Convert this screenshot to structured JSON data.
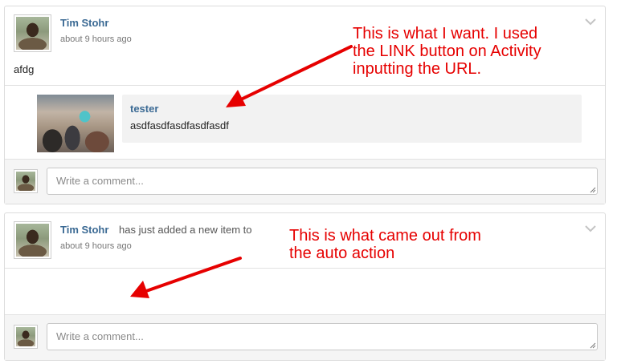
{
  "posts": [
    {
      "author": "Tim Stohr",
      "action_text": "",
      "timestamp": "about 9 hours ago",
      "body": "afdg",
      "attachment": {
        "title": "tester",
        "description": "asdfasdfasdfasdfasdf"
      },
      "comment_placeholder": "Write a comment..."
    },
    {
      "author": "Tim Stohr",
      "action_text": "has just added a new item to",
      "timestamp": "about 9 hours ago",
      "comment_placeholder": "Write a comment..."
    }
  ],
  "annotations": [
    {
      "text": "This is what I want. I used\nthe LINK button on Activity\ninputting the URL.",
      "color": "#e60000"
    },
    {
      "text": "This is what came out from\nthe auto action",
      "color": "#e60000"
    }
  ],
  "icons": {
    "options": "chevron-down-icon",
    "resize": "resize-grip-icon"
  },
  "colors": {
    "link": "#3b6a94",
    "annotation": "#e60000",
    "attachment_bg": "#f2f2f2"
  }
}
